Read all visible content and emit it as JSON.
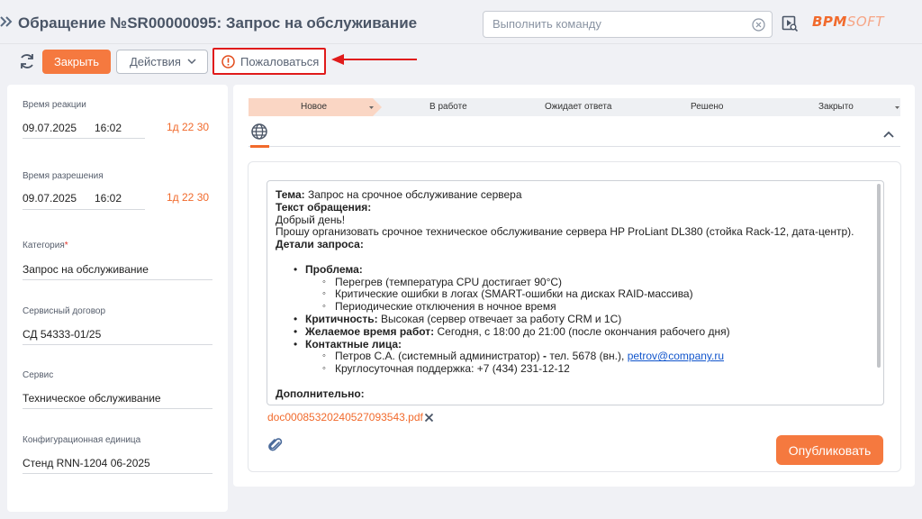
{
  "header": {
    "title": "Обращение №SR00000095: Запрос на обслуживание",
    "command_placeholder": "Выполнить команду",
    "logo_main": "ВРМ",
    "logo_light": "SOFT"
  },
  "toolbar": {
    "close_label": "Закрыть",
    "actions_label": "Действия",
    "complain_label": "Пожаловаться"
  },
  "colors": {
    "accent": "#f5793f",
    "highlight_border": "#e01b1b",
    "link": "#1155cc"
  },
  "icons": [
    "collapse-arrows-icon",
    "clear-icon",
    "play-search-icon",
    "refresh-icon",
    "chevron-down-icon",
    "warning-icon",
    "globe-icon",
    "chevron-up-icon",
    "close-icon",
    "paperclip-icon"
  ],
  "left_panel": {
    "reaction": {
      "label": "Время реакции",
      "date": "09.07.2025",
      "time": "16:02",
      "remaining": "1д 22 30"
    },
    "resolution": {
      "label": "Время разрешения",
      "date": "09.07.2025",
      "time": "16:02",
      "remaining": "1д 22 30"
    },
    "category": {
      "label": "Категория",
      "required_mark": "*",
      "value": "Запрос на обслуживание"
    },
    "contract": {
      "label": "Сервисный договор",
      "value": "СД 54333-01/25"
    },
    "service": {
      "label": "Сервис",
      "value": "Техническое обслуживание"
    },
    "config_item": {
      "label": "Конфигурационная единица",
      "value": "Стенд RNN-1204 06-2025"
    }
  },
  "stages": [
    "Новое",
    "В работе",
    "Ожидает ответа",
    "Решено",
    "Закрыто"
  ],
  "active_stage": "Новое",
  "message": {
    "subject_label": "Тема:",
    "subject": "Запрос на срочное обслуживание сервера",
    "body_label": "Текст обращения:",
    "greeting": "Добрый день!",
    "request": "Прошу организовать срочное техническое обслуживание сервера HP ProLiant DL380 (стойка Rack-12, дата-центр).",
    "details_label": "Детали запроса:",
    "problem_label": "Проблема:",
    "problems": [
      "Перегрев (температура CPU достигает 90°C)",
      "Критические ошибки в логах (SMART-ошибки на дисках RAID-массива)",
      "Периодические отключения в ночное время"
    ],
    "criticality_label": "Критичность:",
    "criticality": "Высокая (сервер отвечает за работу CRM и 1С)",
    "time_label": "Желаемое время работ:",
    "time": "Сегодня, с 18:00 до 21:00 (после окончания рабочего дня)",
    "contacts_label": "Контактные лица:",
    "contact1_prefix": "Петров С.А. (системный администратор)",
    "contact1_sep": "-",
    "contact1_phone": "тел. 5678 (вн.),",
    "contact1_email": "petrov@company.ru",
    "contact2": "Круглосуточная поддержка: +7 (434) 231-12-12",
    "additional_label": "Дополнительно:"
  },
  "attachment": {
    "filename": "doc00085320240527093543.pdf"
  },
  "publish_label": "Опубликовать"
}
